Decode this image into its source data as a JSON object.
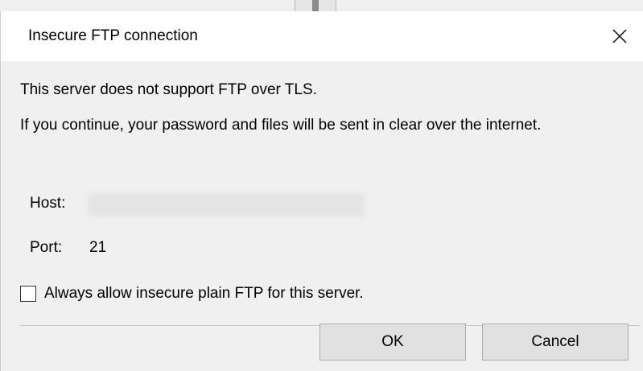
{
  "dialog": {
    "title": "Insecure FTP connection",
    "message_line1": "This server does not support FTP over TLS.",
    "message_line2": "If you continue, your password and files will be sent in clear over the internet.",
    "host": {
      "label": "Host:"
    },
    "port": {
      "label": "Port:",
      "value": "21"
    },
    "checkbox": {
      "label": "Always allow insecure plain FTP for this server.",
      "checked": false
    },
    "buttons": {
      "ok": "OK",
      "cancel": "Cancel"
    }
  },
  "icons": {
    "close": "close-icon"
  },
  "colors": {
    "background": "#f0f0f0",
    "titlebar": "#ffffff",
    "button": "#e1e1e1",
    "button_border": "#adadad"
  }
}
